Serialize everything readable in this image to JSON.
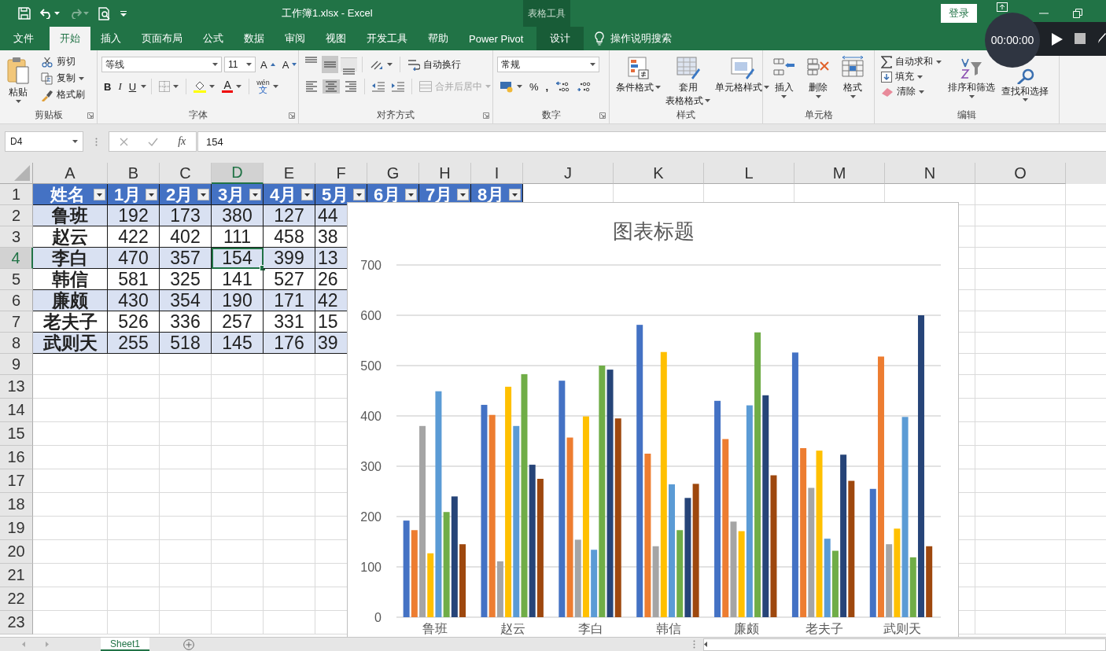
{
  "title_bar": {
    "title": "工作簿1.xlsx  -  Excel",
    "context_label": "表格工具",
    "sign_in": "登录"
  },
  "recorder": {
    "time": "00:00:00"
  },
  "tabs": [
    {
      "label": "文件",
      "selected": false,
      "kind": "normal"
    },
    {
      "label": "开始",
      "selected": true,
      "kind": "normal"
    },
    {
      "label": "插入",
      "selected": false,
      "kind": "normal"
    },
    {
      "label": "页面布局",
      "selected": false,
      "kind": "normal"
    },
    {
      "label": "公式",
      "selected": false,
      "kind": "normal"
    },
    {
      "label": "数据",
      "selected": false,
      "kind": "normal"
    },
    {
      "label": "审阅",
      "selected": false,
      "kind": "normal"
    },
    {
      "label": "视图",
      "selected": false,
      "kind": "normal"
    },
    {
      "label": "开发工具",
      "selected": false,
      "kind": "normal"
    },
    {
      "label": "帮助",
      "selected": false,
      "kind": "normal"
    },
    {
      "label": "Power Pivot",
      "selected": false,
      "kind": "normal"
    },
    {
      "label": "设计",
      "selected": false,
      "kind": "context"
    }
  ],
  "tell_me": "操作说明搜索",
  "ribbon": {
    "clipboard": {
      "label": "剪贴板",
      "paste": "粘贴",
      "cut": "剪切",
      "copy": "复制",
      "painter": "格式刷"
    },
    "font": {
      "label": "字体",
      "family": "等线",
      "size": "11",
      "grow": "A",
      "shrink": "A",
      "buttons": [
        {
          "kind": "bold",
          "label": "B"
        },
        {
          "kind": "italic",
          "label": "I"
        },
        {
          "kind": "underline",
          "label": "U"
        }
      ],
      "font_color": "A",
      "phonetic_top": "wén",
      "phonetic_bottom": "文"
    },
    "alignment": {
      "label": "对齐方式",
      "vertical": [
        {
          "kind": "top",
          "selected": false
        },
        {
          "kind": "middle",
          "selected": true
        },
        {
          "kind": "bottom",
          "selected": false
        }
      ],
      "horizontal": [
        {
          "kind": "left",
          "selected": false
        },
        {
          "kind": "center",
          "selected": true
        },
        {
          "kind": "right",
          "selected": false
        }
      ],
      "wrap": "自动换行",
      "merge": {
        "label": "合并后居中",
        "disabled": true
      }
    },
    "number": {
      "label": "数字",
      "format": "常规",
      "percent": "%",
      "comma": ","
    },
    "styles": {
      "label": "样式",
      "items": [
        {
          "kind": "conditional",
          "lines": [
            "条件格式"
          ]
        },
        {
          "kind": "table",
          "lines": [
            "套用",
            "表格格式"
          ]
        },
        {
          "kind": "cell",
          "lines": [
            "单元格样式"
          ]
        }
      ]
    },
    "cells": {
      "label": "单元格",
      "items": [
        {
          "kind": "insert",
          "label": "插入"
        },
        {
          "kind": "delete",
          "label": "删除"
        },
        {
          "kind": "format",
          "label": "格式"
        }
      ]
    },
    "editing": {
      "label": "编辑",
      "autosum": "自动求和",
      "fill": "填充",
      "clear": "清除",
      "sort": "排序和筛选",
      "find": "查找和选择"
    }
  },
  "formula_bar": {
    "name_box": "D4",
    "fx": "fx",
    "formula": "154"
  },
  "sheet": {
    "columns": [
      {
        "label": "A",
        "selected": false
      },
      {
        "label": "B",
        "selected": false
      },
      {
        "label": "C",
        "selected": false
      },
      {
        "label": "D",
        "selected": true
      },
      {
        "label": "E",
        "selected": false
      },
      {
        "label": "F",
        "selected": false
      },
      {
        "label": "G",
        "selected": false
      },
      {
        "label": "H",
        "selected": false
      },
      {
        "label": "I",
        "selected": false
      },
      {
        "label": "J",
        "selected": false
      },
      {
        "label": "K",
        "selected": false
      },
      {
        "label": "L",
        "selected": false
      },
      {
        "label": "M",
        "selected": false
      },
      {
        "label": "N",
        "selected": false
      },
      {
        "label": "O",
        "selected": false
      }
    ],
    "rows": [
      {
        "label": "1",
        "selected": false
      },
      {
        "label": "2",
        "selected": false
      },
      {
        "label": "3",
        "selected": false
      },
      {
        "label": "4",
        "selected": true
      },
      {
        "label": "5",
        "selected": false
      },
      {
        "label": "6",
        "selected": false
      },
      {
        "label": "7",
        "selected": false
      },
      {
        "label": "8",
        "selected": false
      },
      {
        "label": "9",
        "selected": false
      },
      {
        "label": "13",
        "selected": false
      },
      {
        "label": "14",
        "selected": false
      },
      {
        "label": "15",
        "selected": false
      },
      {
        "label": "16",
        "selected": false
      },
      {
        "label": "17",
        "selected": false
      },
      {
        "label": "18",
        "selected": false
      },
      {
        "label": "19",
        "selected": false
      },
      {
        "label": "20",
        "selected": false
      },
      {
        "label": "21",
        "selected": false
      },
      {
        "label": "22",
        "selected": false
      },
      {
        "label": "23",
        "selected": false
      }
    ],
    "table": {
      "header": [
        "姓名",
        "1月",
        "2月",
        "3月",
        "4月",
        "5月",
        "6月",
        "7月",
        "8月"
      ],
      "rows": [
        {
          "cells": [
            {
              "text": "鲁班",
              "selected": false
            },
            {
              "text": "192",
              "selected": false
            },
            {
              "text": "173",
              "selected": false
            },
            {
              "text": "380",
              "selected": false
            },
            {
              "text": "127",
              "selected": false
            },
            {
              "text": "44",
              "selected": false
            }
          ]
        },
        {
          "cells": [
            {
              "text": "赵云",
              "selected": false
            },
            {
              "text": "422",
              "selected": false
            },
            {
              "text": "402",
              "selected": false
            },
            {
              "text": "111",
              "selected": false
            },
            {
              "text": "458",
              "selected": false
            },
            {
              "text": "38",
              "selected": false
            }
          ]
        },
        {
          "cells": [
            {
              "text": "李白",
              "selected": false
            },
            {
              "text": "470",
              "selected": false
            },
            {
              "text": "357",
              "selected": false
            },
            {
              "text": "154",
              "selected": true
            },
            {
              "text": "399",
              "selected": false
            },
            {
              "text": "13",
              "selected": false
            }
          ]
        },
        {
          "cells": [
            {
              "text": "韩信",
              "selected": false
            },
            {
              "text": "581",
              "selected": false
            },
            {
              "text": "325",
              "selected": false
            },
            {
              "text": "141",
              "selected": false
            },
            {
              "text": "527",
              "selected": false
            },
            {
              "text": "26",
              "selected": false
            }
          ]
        },
        {
          "cells": [
            {
              "text": "廉颇",
              "selected": false
            },
            {
              "text": "430",
              "selected": false
            },
            {
              "text": "354",
              "selected": false
            },
            {
              "text": "190",
              "selected": false
            },
            {
              "text": "171",
              "selected": false
            },
            {
              "text": "42",
              "selected": false
            }
          ]
        },
        {
          "cells": [
            {
              "text": "老夫子",
              "selected": false
            },
            {
              "text": "526",
              "selected": false
            },
            {
              "text": "336",
              "selected": false
            },
            {
              "text": "257",
              "selected": false
            },
            {
              "text": "331",
              "selected": false
            },
            {
              "text": "15",
              "selected": false
            }
          ]
        },
        {
          "cells": [
            {
              "text": "武则天",
              "selected": false
            },
            {
              "text": "255",
              "selected": false
            },
            {
              "text": "518",
              "selected": false
            },
            {
              "text": "145",
              "selected": false
            },
            {
              "text": "176",
              "selected": false
            },
            {
              "text": "39",
              "selected": false
            }
          ]
        }
      ]
    }
  },
  "chart": {
    "chart_data": {
      "type": "bar",
      "title": "图表标题",
      "categories": [
        "鲁班",
        "赵云",
        "李白",
        "韩信",
        "廉颇",
        "老夫子",
        "武则天"
      ],
      "ylim": [
        0,
        700
      ],
      "grid": true,
      "yticks": [
        0,
        100,
        200,
        300,
        400,
        500,
        600,
        700
      ],
      "series": [
        {
          "color": "#4472c4",
          "values": [
            192,
            422,
            470,
            581,
            430,
            526,
            255
          ]
        },
        {
          "color": "#ed7d31",
          "values": [
            173,
            402,
            357,
            325,
            354,
            336,
            518
          ]
        },
        {
          "color": "#a5a5a5",
          "values": [
            380,
            111,
            154,
            141,
            190,
            257,
            145
          ]
        },
        {
          "color": "#ffc000",
          "values": [
            127,
            458,
            399,
            527,
            171,
            331,
            176
          ]
        },
        {
          "color": "#5b9bd5",
          "values": [
            449,
            380,
            134,
            264,
            421,
            156,
            398
          ]
        },
        {
          "color": "#70ad47",
          "values": [
            209,
            483,
            500,
            173,
            566,
            132,
            119
          ]
        },
        {
          "color": "#264478",
          "values": [
            240,
            303,
            492,
            237,
            441,
            323,
            600
          ]
        },
        {
          "color": "#9e480e",
          "values": [
            145,
            275,
            395,
            265,
            282,
            271,
            141
          ]
        }
      ]
    }
  },
  "sheet_tabs": [
    {
      "label": "Sheet1",
      "selected": true
    }
  ]
}
